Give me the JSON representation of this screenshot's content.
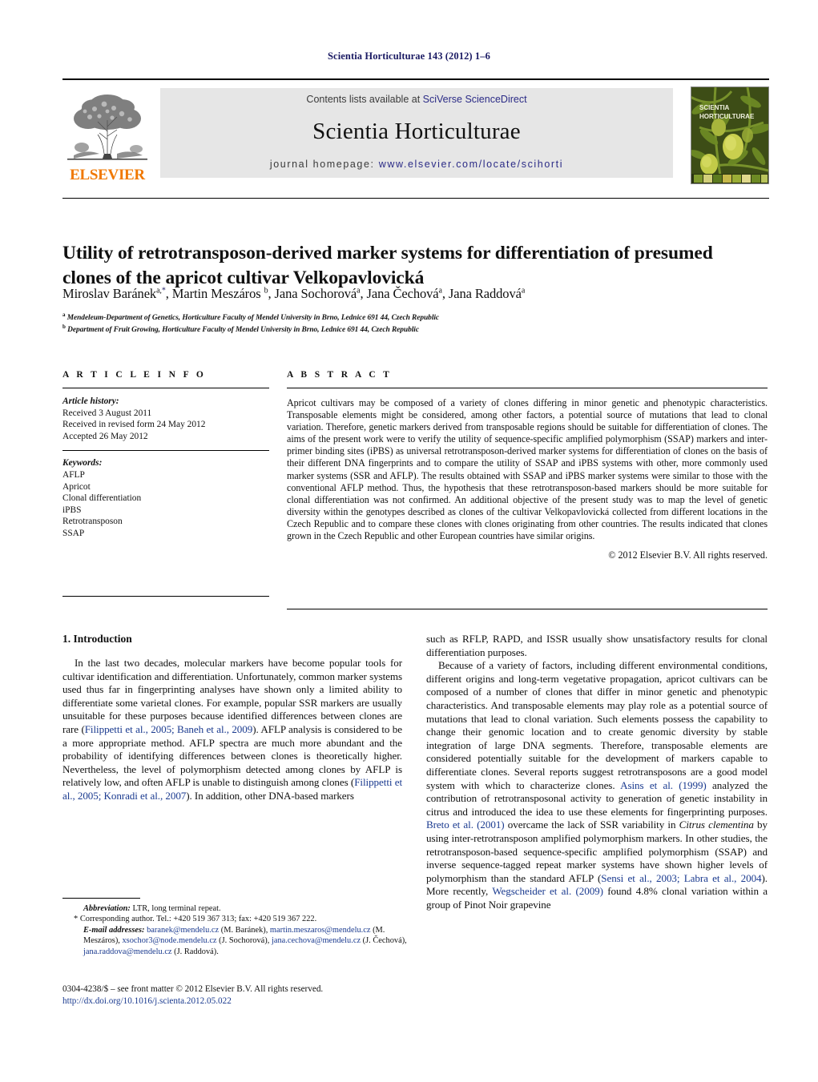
{
  "running_head": "Scientia Horticulturae 143 (2012) 1–6",
  "masthead": {
    "contents_prefix": "Contents lists available at ",
    "contents_link": "SciVerse ScienceDirect",
    "journal_title": "Scientia Horticulturae",
    "homepage_prefix": "journal homepage: ",
    "homepage_url": "www.elsevier.com/locate/scihorti",
    "publisher_wordmark": "ELSEVIER",
    "publisher_color": "#F07800",
    "cover_title_line1": "SCIENTIA",
    "cover_title_line2": "HORTICULTURAE"
  },
  "article": {
    "title": "Utility of retrotransposon-derived marker systems for differentiation of presumed clones of the apricot cultivar Velkopavlovická",
    "authors_html": "Miroslav Baránek<sup>a,<span class=\"star\">*</span></sup>, Martin Meszáros <sup>b</sup>, Jana Sochorová<sup>a</sup>, Jana Čechová<sup>a</sup>, Jana Raddová<sup>a</sup>",
    "affiliation_a": "Mendeleum-Department of Genetics, Horticulture Faculty of Mendel University in Brno, Lednice 691 44, Czech Republic",
    "affiliation_b": "Department of Fruit Growing, Horticulture Faculty of Mendel University in Brno, Lednice 691 44, Czech Republic"
  },
  "info": {
    "heading": "A R T I C L E    I N F O",
    "history_label": "Article history:",
    "history": [
      "Received 3 August 2011",
      "Received in revised form 24 May 2012",
      "Accepted 26 May 2012"
    ],
    "keywords_label": "Keywords:",
    "keywords": [
      "AFLP",
      "Apricot",
      "Clonal differentiation",
      "iPBS",
      "Retrotransposon",
      "SSAP"
    ]
  },
  "abstract": {
    "heading": "A B S T R A C T",
    "text": "Apricot cultivars may be composed of a variety of clones differing in minor genetic and phenotypic characteristics. Transposable elements might be considered, among other factors, a potential source of mutations that lead to clonal variation. Therefore, genetic markers derived from transposable regions should be suitable for differentiation of clones. The aims of the present work were to verify the utility of sequence-specific amplified polymorphism (SSAP) markers and inter-primer binding sites (iPBS) as universal retrotransposon-derived marker systems for differentiation of clones on the basis of their different DNA fingerprints and to compare the utility of SSAP and iPBS systems with other, more commonly used marker systems (SSR and AFLP). The results obtained with SSAP and iPBS marker systems were similar to those with the conventional AFLP method. Thus, the hypothesis that these retrotransposon-based markers should be more suitable for clonal differentiation was not confirmed. An additional objective of the present study was to map the level of genetic diversity within the genotypes described as clones of the cultivar Velkopavlovická collected from different locations in the Czech Republic and to compare these clones with clones originating from other countries. The results indicated that clones grown in the Czech Republic and other European countries have similar origins.",
    "copyright": "© 2012 Elsevier B.V. All rights reserved."
  },
  "body": {
    "section1_heading": "1.  Introduction",
    "left_p1_html": "In the last two decades, molecular markers have become popular tools for cultivar identification and differentiation. Unfortunately, common marker systems used thus far in fingerprinting analyses have shown only a limited ability to differentiate some varietal clones. For example, popular SSR markers are usually unsuitable for these purposes because identified differences between clones are rare (<span class=\"cite\">Filippetti et al., 2005; Baneh et al., 2009</span>). AFLP analysis is considered to be a more appropriate method. AFLP spectra are much more abundant and the probability of identifying differences between clones is theoretically higher. Nevertheless, the level of polymorphism detected among clones by AFLP is relatively low, and often AFLP is unable to distinguish among clones (<span class=\"cite\">Filippetti et al., 2005; Konradi et al., 2007</span>). In addition, other DNA-based markers",
    "right_p1_html": "such as RFLP, RAPD, and ISSR usually show unsatisfactory results for clonal differentiation purposes.",
    "right_p2_html": "Because of a variety of factors, including different environmental conditions, different origins and long-term vegetative propagation, apricot cultivars can be composed of a number of clones that differ in minor genetic and phenotypic characteristics. And transposable elements may play role as a potential source of mutations that lead to clonal variation. Such elements possess the capability to change their genomic location and to create genomic diversity by stable integration of large DNA segments. Therefore, transposable elements are considered potentially suitable for the development of markers capable to differentiate clones. Several reports suggest retrotransposons are a good model system with which to characterize clones. <span class=\"cite\">Asins et al. (1999)</span> analyzed the contribution of retrotransposonal activity to generation of genetic instability in citrus and introduced the idea to use these elements for fingerprinting purposes. <span class=\"cite\">Breto et al. (2001)</span> overcame the lack of SSR variability in <span class=\"ital\">Citrus clementina</span> by using inter-retrotransposon amplified polymorphism markers. In other studies, the retrotransposon-based sequence-specific amplified polymorphism (SSAP) and inverse sequence-tagged repeat marker systems have shown higher levels of polymorphism than the standard AFLP (<span class=\"cite\">Sensi et al., 2003; Labra et al., 2004</span>). More recently, <span class=\"cite\">Wegscheider et al. (2009)</span> found 4.8% clonal variation within a group of Pinot Noir grapevine"
  },
  "footnotes": {
    "abbreviation_label": "Abbreviation:",
    "abbreviation_text": "LTR, long terminal repeat.",
    "corresponding_text": "Corresponding author. Tel.: +420 519 367 313; fax: +420 519 367 222.",
    "email_label": "E-mail addresses:",
    "emails_html": "<span class=\"mail\">baranek@mendelu.cz</span> (M. Baránek), <span class=\"mail\">martin.meszaros@mendelu.cz</span> (M. Meszáros), <span class=\"mail\">xsochor3@node.mendelu.cz</span> (J. Sochorová), <span class=\"mail\">jana.cechova@mendelu.cz</span> (J. Čechová), <span class=\"mail\">jana.raddova@mendelu.cz</span> (J. Raddová)."
  },
  "footer": {
    "issn_line": "0304-4238/$ – see front matter © 2012 Elsevier B.V. All rights reserved.",
    "doi_line": "http://dx.doi.org/10.1016/j.scienta.2012.05.022"
  }
}
